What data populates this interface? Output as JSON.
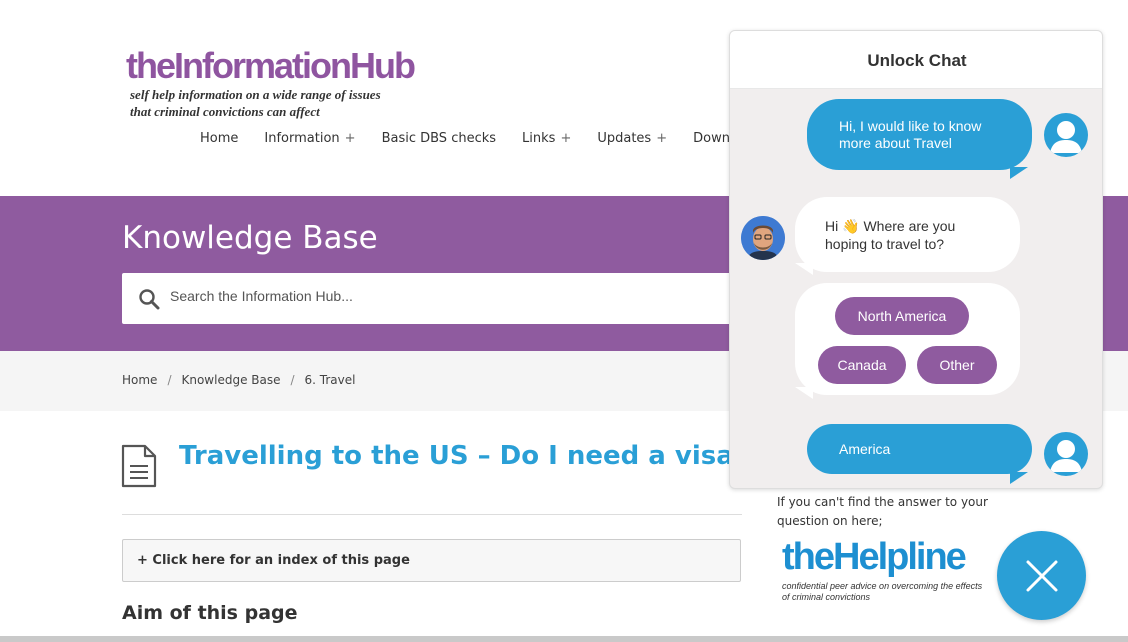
{
  "site": {
    "logo_title": "theInformationHub",
    "logo_tagline_1": "self help information on a wide range of issues",
    "logo_tagline_2": "that criminal convictions can affect"
  },
  "nav": {
    "items": [
      {
        "label": "Home",
        "plus": ""
      },
      {
        "label": "Information",
        "plus": "+"
      },
      {
        "label": "Basic DBS checks",
        "plus": ""
      },
      {
        "label": "Links",
        "plus": "+"
      },
      {
        "label": "Updates",
        "plus": "+"
      },
      {
        "label": "Downlo",
        "plus": ""
      }
    ]
  },
  "banner": {
    "title": "Knowledge Base",
    "search_placeholder": "Search the Information Hub..."
  },
  "breadcrumb": {
    "items": [
      "Home",
      "Knowledge Base",
      "6. Travel"
    ],
    "separator": "/"
  },
  "article": {
    "title": "Travelling to the US – Do I need a visa?",
    "index_toggle": "+ Click here for an index of this page",
    "aim_heading": "Aim of this page"
  },
  "sidebar": {
    "help_text": "If you can't find the answer to your question on here;",
    "helpline_title": "theHelpline",
    "helpline_tag_1": "confidential peer advice on overcoming the effects",
    "helpline_tag_2": "of criminal convictions"
  },
  "chat": {
    "title": "Unlock Chat",
    "msg_user_1": "Hi, I would like to know more about Travel",
    "msg_bot_1_prefix": "Hi",
    "msg_bot_1_emoji": "👋",
    "msg_bot_1_rest": "Where are you hoping to travel to?",
    "options": [
      "North America",
      "Canada",
      "Other"
    ],
    "msg_user_2": "America"
  },
  "colors": {
    "brand_purple": "#8f5b9f",
    "accent_blue": "#2a9fd6"
  },
  "icons": {
    "search": "search-icon",
    "document": "document-icon",
    "close": "close-icon",
    "user_avatar": "user-avatar-icon"
  }
}
